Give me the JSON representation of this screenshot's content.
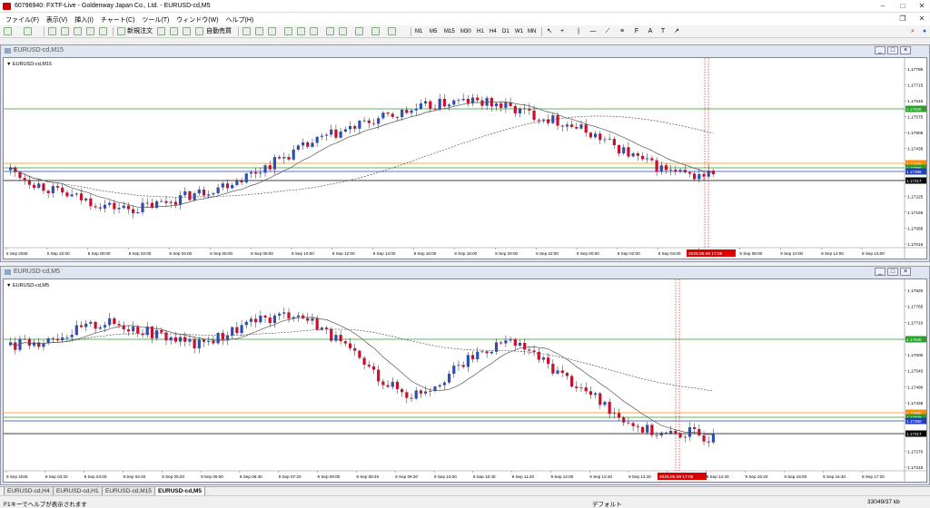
{
  "window": {
    "title": "60796940: FXTF-Live - Goldenway Japan Co., Ltd. - EURUSD-cd,M5"
  },
  "menu": [
    "ファイル(F)",
    "表示(V)",
    "挿入(I)",
    "チャート(C)",
    "ツール(T)",
    "ウィンドウ(W)",
    "ヘルプ(H)"
  ],
  "toolbar": {
    "new_order": "新規注文",
    "auto_trade": "自動売買",
    "timeframes": [
      "M1",
      "M5",
      "M15",
      "M30",
      "H1",
      "H4",
      "D1",
      "W1",
      "MN"
    ]
  },
  "charts": [
    {
      "window_title": "EURUSD-cd,M15",
      "label": "▼ EURUSD-cd,M15",
      "price_ticks": [
        "1.17785",
        "1.17715",
        "1.17645",
        "1.17575",
        "1.17505",
        "1.17435",
        "1.17365",
        "1.17295",
        "1.17225",
        "1.17155",
        "1.17085",
        "1.17015"
      ],
      "hlines": [
        {
          "label": "1.17620",
          "color": "#2a9d2a"
        },
        {
          "label": "1.17408",
          "color": "#ff8c00"
        },
        {
          "label": "1.17380",
          "color": "#2a9d2a"
        },
        {
          "label": "1.17366",
          "color": "#1f3fbf"
        },
        {
          "label": "1.17317",
          "color": "#000000"
        }
      ],
      "time_ticks": [
        "5 Sep 2025",
        "5 Sep 22:00",
        "8 Sep 00:00",
        "8 Sep 02:00",
        "8 Sep 04:00",
        "8 Sep 06:00",
        "8 Sep 08:00",
        "8 Sep 10:00",
        "8 Sep 12:00",
        "8 Sep 14:00",
        "8 Sep 16:00",
        "8 Sep 18:00",
        "8 Sep 20:00",
        "8 Sep 22:00",
        "9 Sep 00:00",
        "9 Sep 02:00",
        "9 Sep 04:00",
        "9 Sep 06:00",
        "9 Sep 08:00",
        "9 Sep 10:00",
        "9 Sep 12:00",
        "9 Sep 14:00"
      ],
      "cursor_time": "2025.09.09 17:05",
      "trend": [
        0.44,
        0.36,
        0.3,
        0.26,
        0.22,
        0.2,
        0.23,
        0.27,
        0.31,
        0.36,
        0.42,
        0.5,
        0.57,
        0.64,
        0.69,
        0.74,
        0.78,
        0.82,
        0.85,
        0.86,
        0.84,
        0.8,
        0.76,
        0.72,
        0.66,
        0.58,
        0.5,
        0.44,
        0.4,
        0.42
      ]
    },
    {
      "window_title": "EURUSD-cd,M5",
      "label": "▼ EURUSD-cd,M5",
      "price_ticks": [
        "1.17820",
        "1.17765",
        "1.17710",
        "1.17655",
        "1.17600",
        "1.17545",
        "1.17490",
        "1.17435",
        "1.17380",
        "1.17325",
        "1.17270",
        "1.17215"
      ],
      "hlines": [
        {
          "label": "1.17620",
          "color": "#2a9d2a"
        },
        {
          "label": "1.17408",
          "color": "#ff8c00"
        },
        {
          "label": "1.17378",
          "color": "#2a9d2a"
        },
        {
          "label": "1.17360",
          "color": "#1f3fbf"
        },
        {
          "label": "1.17317",
          "color": "#000000"
        }
      ],
      "time_ticks": [
        "9 Sep 2025",
        "9 Sep 03:20",
        "9 Sep 04:00",
        "9 Sep 04:40",
        "9 Sep 05:20",
        "9 Sep 06:00",
        "9 Sep 06:40",
        "9 Sep 07:20",
        "9 Sep 08:00",
        "9 Sep 08:40",
        "9 Sep 09:20",
        "9 Sep 10:00",
        "9 Sep 10:40",
        "9 Sep 11:20",
        "9 Sep 12:00",
        "9 Sep 12:40",
        "9 Sep 13:20",
        "9 Sep 14:00",
        "9 Sep 14:40",
        "9 Sep 15:20",
        "9 Sep 16:00",
        "9 Sep 16:40",
        "9 Sep 17:20"
      ],
      "cursor_time": "2025.09.09 17:05",
      "trend": [
        0.72,
        0.74,
        0.78,
        0.82,
        0.86,
        0.84,
        0.8,
        0.76,
        0.72,
        0.78,
        0.84,
        0.88,
        0.92,
        0.86,
        0.74,
        0.62,
        0.5,
        0.42,
        0.48,
        0.58,
        0.68,
        0.74,
        0.7,
        0.6,
        0.5,
        0.4,
        0.3,
        0.22,
        0.18,
        0.2,
        0.16
      ]
    }
  ],
  "tabs": [
    "EURUSD-cd,H4",
    "EURUSD-cd,H1",
    "EURUSD-cd,M15",
    "EURUSD-cd,M5"
  ],
  "status": {
    "help": "F1キーでヘルプが表示されます",
    "profile": "デフォルト",
    "traffic": "33049/37 kb"
  }
}
